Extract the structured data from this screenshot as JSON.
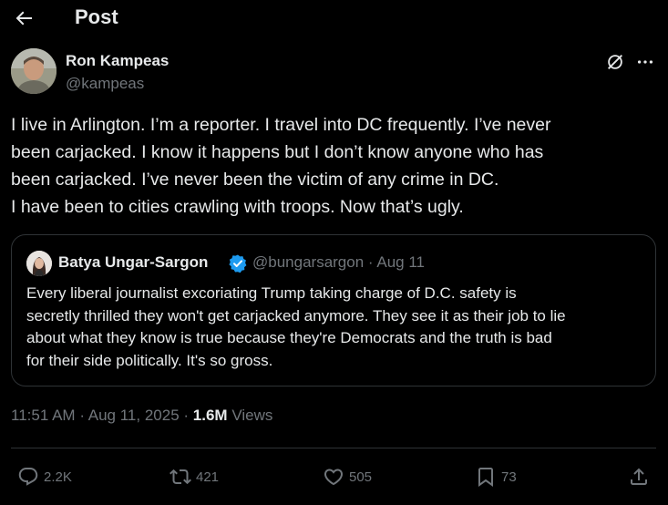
{
  "header": {
    "title": "Post"
  },
  "author": {
    "name": "Ron Kampeas",
    "handle": "@kampeas"
  },
  "tweet": {
    "lines": [
      "I live in Arlington. I’m a reporter. I travel into DC frequently. I’ve never",
      "been carjacked. I know it happens but I don’t know anyone who has",
      "been carjacked. I’ve never been the victim of any crime in DC.",
      "I have been to cities crawling with troops. Now that’s ugly."
    ]
  },
  "quote": {
    "name": "Batya Ungar-Sargon",
    "handle": "@bungarsargon",
    "date": "Aug 11",
    "lines": [
      "Every liberal journalist excoriating Trump taking charge of D.C. safety is",
      "secretly thrilled they won't get carjacked anymore. They see it as their job to lie",
      "about what they know is true because they're Democrats and the truth is bad",
      "for their side politically.  It's so gross."
    ]
  },
  "meta": {
    "time": "11:51 AM",
    "date": "Aug 11, 2025",
    "views_count": "1.6M",
    "views_label": "Views"
  },
  "actions": {
    "replies": "2.2K",
    "reposts": "421",
    "likes": "505",
    "bookmarks": "73"
  },
  "colors": {
    "background": "#000000",
    "text": "#e7e9ea",
    "muted": "#71767b",
    "border": "#2f3336",
    "verified": "#1d9bf0"
  }
}
